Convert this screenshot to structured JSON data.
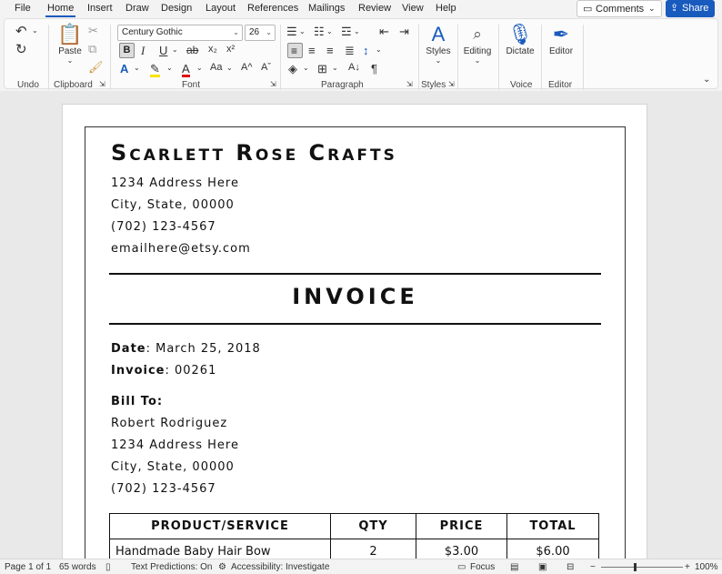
{
  "menu": {
    "tabs": [
      "File",
      "Home",
      "Insert",
      "Draw",
      "Design",
      "Layout",
      "References",
      "Mailings",
      "Review",
      "View",
      "Help"
    ],
    "comments_label": "Comments",
    "share_label": "Share"
  },
  "ribbon": {
    "font_name": "Century Gothic",
    "font_size": "26",
    "paste_label": "Paste",
    "styles_label": "Styles",
    "editing_label": "Editing",
    "dictate_label": "Dictate",
    "editor_label": "Editor",
    "groups": {
      "undo": "Undo",
      "clipboard": "Clipboard",
      "font": "Font",
      "paragraph": "Paragraph",
      "styles": "Styles",
      "voice": "Voice",
      "editor": "Editor"
    },
    "accent_color": "#185abd"
  },
  "document": {
    "company": "Scarlett Rose Crafts",
    "address_lines": [
      "1234 Address Here",
      "City, State, 00000",
      "(702) 123-4567",
      "emailhere@etsy.com"
    ],
    "title": "INVOICE",
    "date_label": "Date",
    "date_value": ": March 25, 2018",
    "invoice_label": "Invoice",
    "invoice_value": ": 00261",
    "bill_to_label": "Bill To",
    "bill_to_colon": ":",
    "bill_to_lines": [
      "Robert Rodriguez",
      "1234 Address Here",
      "City, State, 00000",
      "(702) 123-4567"
    ],
    "table": {
      "headers": [
        "PRODUCT/SERVICE",
        "QTY",
        "PRICE",
        "TOTAL"
      ],
      "rows": [
        [
          "Handmade Baby Hair Bow",
          "2",
          "$3.00",
          "$6.00"
        ]
      ]
    }
  },
  "status": {
    "page": "Page 1 of 1",
    "words": "65 words",
    "text_predictions": "Text Predictions: On",
    "accessibility": "Accessibility: Investigate",
    "focus": "Focus",
    "zoom": "100%"
  }
}
